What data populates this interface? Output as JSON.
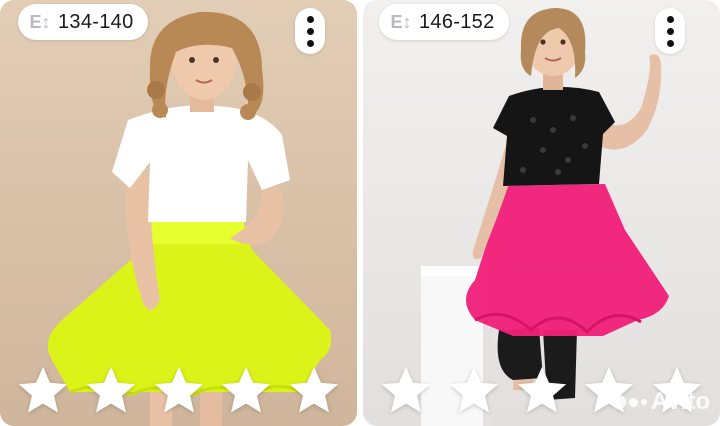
{
  "cards": [
    {
      "size_icon": "height-size-icon",
      "size_label": "134-140",
      "more_icon": "vertical-ellipsis-icon",
      "stars_total": 5,
      "rating": 0
    },
    {
      "size_icon": "height-size-icon",
      "size_label": "146-152",
      "more_icon": "vertical-ellipsis-icon",
      "stars_total": 5,
      "rating": 0,
      "watermark": "Avito"
    }
  ],
  "colors": {
    "left_background": "#d8c0a6",
    "right_background": "#eceae8",
    "left_skirt": "#dcf31a",
    "right_skirt": "#f0207a",
    "star": "#ffffff"
  }
}
